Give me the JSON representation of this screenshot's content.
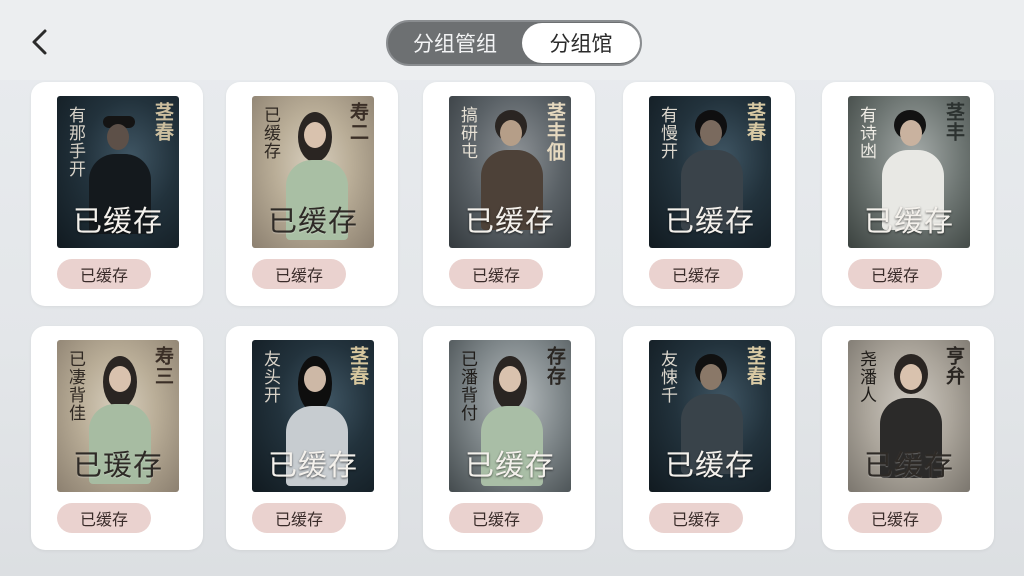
{
  "segmented": {
    "tab_a": "分组管组",
    "tab_b": "分组馆"
  },
  "cards": [
    {
      "title": "茎春",
      "sub": "有那手开",
      "overlay": "已缓存",
      "badge": "已缓存"
    },
    {
      "title": "寿二",
      "sub": "已缓存",
      "overlay": "已缓存",
      "badge": "已缓存"
    },
    {
      "title": "茎丰佃",
      "sub": "搞研屯",
      "overlay": "已缓存",
      "badge": "已缓存"
    },
    {
      "title": "茎春",
      "sub": "有慢开",
      "overlay": "已缓存",
      "badge": "已缓存"
    },
    {
      "title": "茎丰",
      "sub": "有诗凼",
      "overlay": "已缓存",
      "badge": "已缓存"
    },
    {
      "title": "寿三",
      "sub": "已凄背佳",
      "overlay": "已瑗存",
      "badge": "已缓存"
    },
    {
      "title": "茎春",
      "sub": "友头开",
      "overlay": "已缓存",
      "badge": "已缓存"
    },
    {
      "title": "存存",
      "sub": "已潘背付",
      "overlay": "已缓存",
      "badge": "已缓存"
    },
    {
      "title": "茎春",
      "sub": "友悚千",
      "overlay": "已缓存",
      "badge": "已缓存"
    },
    {
      "title": "亨弁",
      "sub": "尧潘人",
      "overlay": "已缓存",
      "badge": "已缓存"
    }
  ],
  "colors": {
    "badge_bg": "#ead2cf",
    "segment_bg": "#6d7072",
    "segment_active_bg": "#ffffff"
  },
  "icons": {
    "back": "chevron-left-icon"
  }
}
